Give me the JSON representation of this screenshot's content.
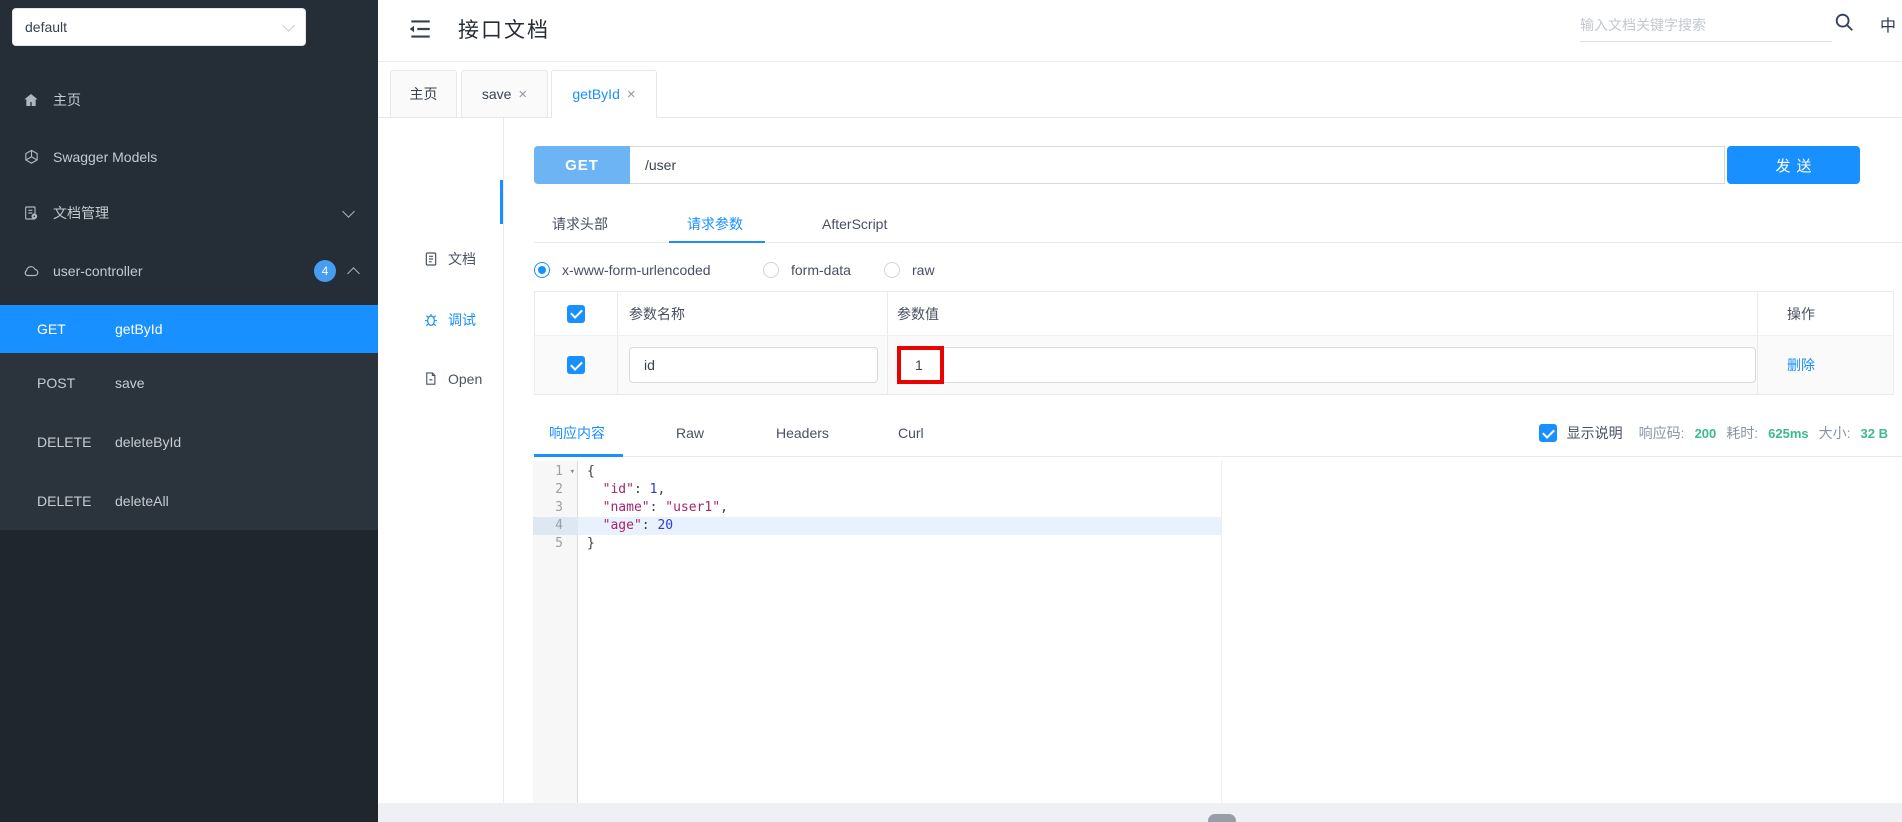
{
  "sidebar": {
    "group_select_value": "default",
    "items": [
      {
        "label": "主页"
      },
      {
        "label": "Swagger Models"
      },
      {
        "label": "文档管理"
      },
      {
        "label": "user-controller",
        "badge": "4"
      }
    ],
    "endpoints": [
      {
        "method": "GET",
        "name": "getById"
      },
      {
        "method": "POST",
        "name": "save"
      },
      {
        "method": "DELETE",
        "name": "deleteById"
      },
      {
        "method": "DELETE",
        "name": "deleteAll"
      }
    ]
  },
  "header": {
    "title": "接口文档",
    "search_placeholder": "输入文档关键字搜索",
    "lang_toggle": "中"
  },
  "tabs": [
    {
      "label": "主页"
    },
    {
      "label": "save"
    },
    {
      "label": "getById"
    }
  ],
  "doc_nav": [
    {
      "label": "文档"
    },
    {
      "label": "调试"
    },
    {
      "label": "Open"
    }
  ],
  "debug": {
    "method": "GET",
    "url": "/user",
    "send_label": "发送",
    "request_tabs": [
      {
        "label": "请求头部"
      },
      {
        "label": "请求参数"
      },
      {
        "label": "AfterScript"
      }
    ],
    "body_types": [
      {
        "label": "x-www-form-urlencoded"
      },
      {
        "label": "form-data"
      },
      {
        "label": "raw"
      }
    ],
    "params_table": {
      "name_header": "参数名称",
      "value_header": "参数值",
      "action_header": "操作",
      "row": {
        "name": "id",
        "value": "1",
        "action_label": "删除"
      }
    }
  },
  "response": {
    "tabs": [
      {
        "label": "响应内容"
      },
      {
        "label": "Raw"
      },
      {
        "label": "Headers"
      },
      {
        "label": "Curl"
      }
    ],
    "show_description_label": "显示说明",
    "stats": [
      {
        "label": "响应码:",
        "value": "200"
      },
      {
        "label": "耗时:",
        "value": "625ms"
      },
      {
        "label": "大小:",
        "value": "32 B"
      }
    ],
    "editor": {
      "lines": [
        {
          "n": "1",
          "fold": true,
          "indent": 0,
          "highlight": false,
          "tokens": [
            {
              "cls": "p",
              "text": "{"
            }
          ]
        },
        {
          "n": "2",
          "fold": false,
          "indent": 1,
          "highlight": false,
          "tokens": [
            {
              "cls": "k",
              "text": "\"id\""
            },
            {
              "cls": "p",
              "text": ": "
            },
            {
              "cls": "n",
              "text": "1"
            },
            {
              "cls": "p",
              "text": ","
            }
          ]
        },
        {
          "n": "3",
          "fold": false,
          "indent": 1,
          "highlight": false,
          "tokens": [
            {
              "cls": "k",
              "text": "\"name\""
            },
            {
              "cls": "p",
              "text": ": "
            },
            {
              "cls": "s",
              "text": "\"user1\""
            },
            {
              "cls": "p",
              "text": ","
            }
          ]
        },
        {
          "n": "4",
          "fold": false,
          "indent": 1,
          "highlight": true,
          "tokens": [
            {
              "cls": "k",
              "text": "\"age\""
            },
            {
              "cls": "p",
              "text": ": "
            },
            {
              "cls": "n",
              "text": "20"
            }
          ]
        },
        {
          "n": "5",
          "fold": false,
          "indent": 0,
          "highlight": false,
          "tokens": [
            {
              "cls": "p",
              "text": "}"
            }
          ]
        }
      ]
    }
  },
  "colors": {
    "accent": "#1890ff",
    "method_get_light": "#6db4f4",
    "success": "#3cb98d",
    "annotation_red": "#e80202"
  }
}
